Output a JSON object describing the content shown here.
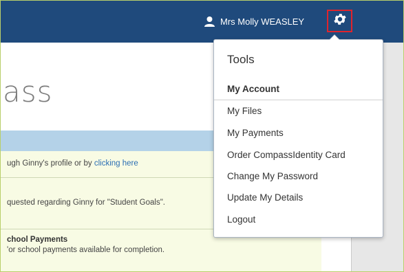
{
  "header": {
    "user_name": "Mrs Molly WEASLEY",
    "colors": {
      "bar": "#1f4a7c",
      "gear_highlight": "#e0242c"
    }
  },
  "main": {
    "logo_fragment": "ass",
    "notices": [
      {
        "text_before": "ugh Ginny's profile or by ",
        "link": "clicking here"
      },
      {
        "text": "quested regarding Ginny for \"Student Goals\"."
      },
      {
        "title": "chool Payments",
        "text": "'or school payments available for completion."
      }
    ]
  },
  "menu": {
    "title": "Tools",
    "section_label": "My Account",
    "items": [
      "My Files",
      "My Payments",
      "Order CompassIdentity Card",
      "Change My Password",
      "Update My Details",
      "Logout"
    ]
  }
}
